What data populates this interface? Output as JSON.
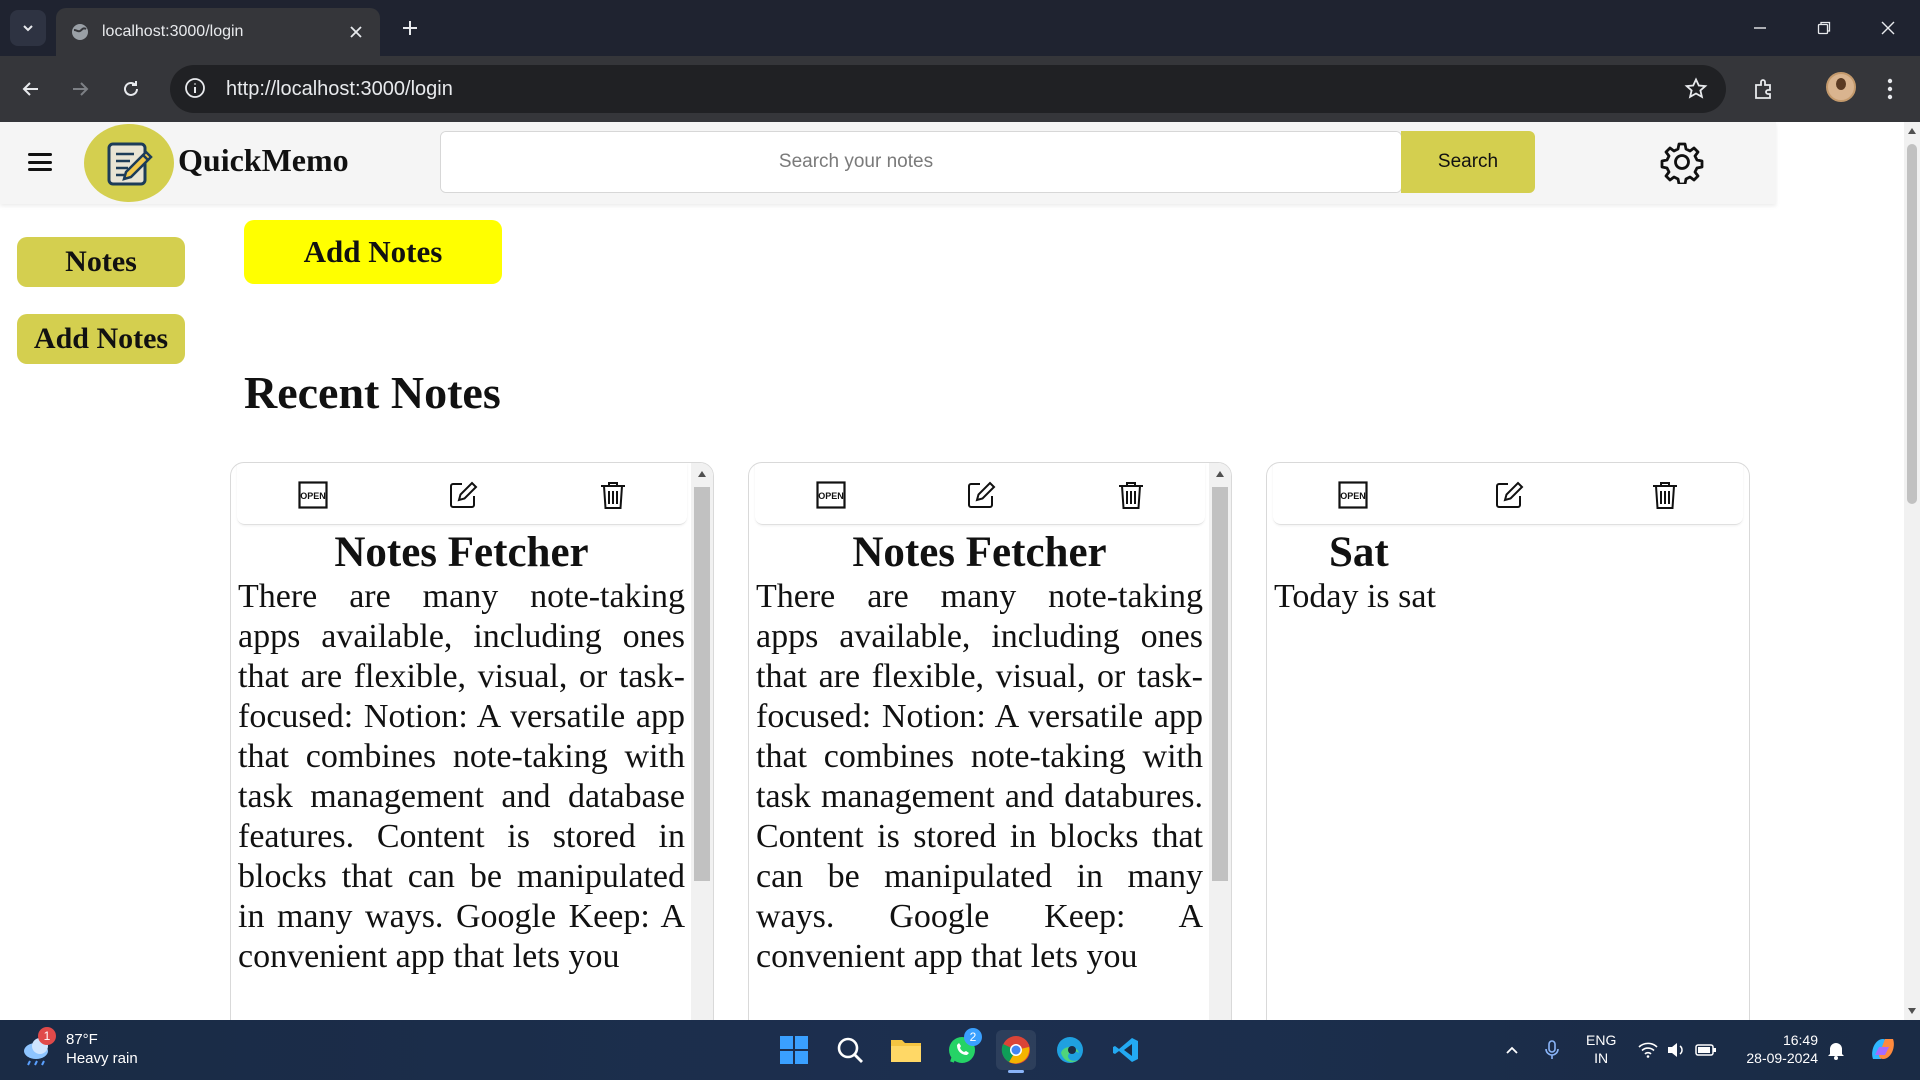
{
  "browser": {
    "tab_title": "localhost:3000/login",
    "url": "http://localhost:3000/login"
  },
  "app": {
    "brand": "QuickMemo",
    "search": {
      "placeholder": "Search your notes",
      "button_label": "Search"
    },
    "sidebar": [
      {
        "label": "Notes"
      },
      {
        "label": "Add Notes"
      }
    ],
    "add_button_label": "Add Notes",
    "section_title": "Recent Notes",
    "notes": [
      {
        "title": "Notes Fetcher",
        "body": "There are many note-taking apps available, including ones that are flexible, visual, or task-focused: Notion: A versatile app that combines note-taking with task management and database features. Content is stored in blocks that can be manipulated in many ways. Google Keep: A convenient app that lets you"
      },
      {
        "title": "Notes Fetcher",
        "body": "There are many note-taking apps available, including ones that are flexible, visual, or task-focused: Notion: A versatile app that combines note-taking with task management and databures. Content is stored in blocks that can be manipulated in many ways. Google Keep: A convenient app that lets you"
      },
      {
        "title": "Sat",
        "body": "Today is sat"
      }
    ]
  },
  "taskbar": {
    "weather": {
      "temp": "87°F",
      "condition": "Heavy rain",
      "badge": "1"
    },
    "whatsapp_badge": "2",
    "lang_top": "ENG",
    "lang_bottom": "IN",
    "time": "16:49",
    "date": "28-09-2024"
  },
  "colors": {
    "accent": "#d4cf4f",
    "add_button": "#ffff00",
    "browser_frame": "#35363a"
  }
}
